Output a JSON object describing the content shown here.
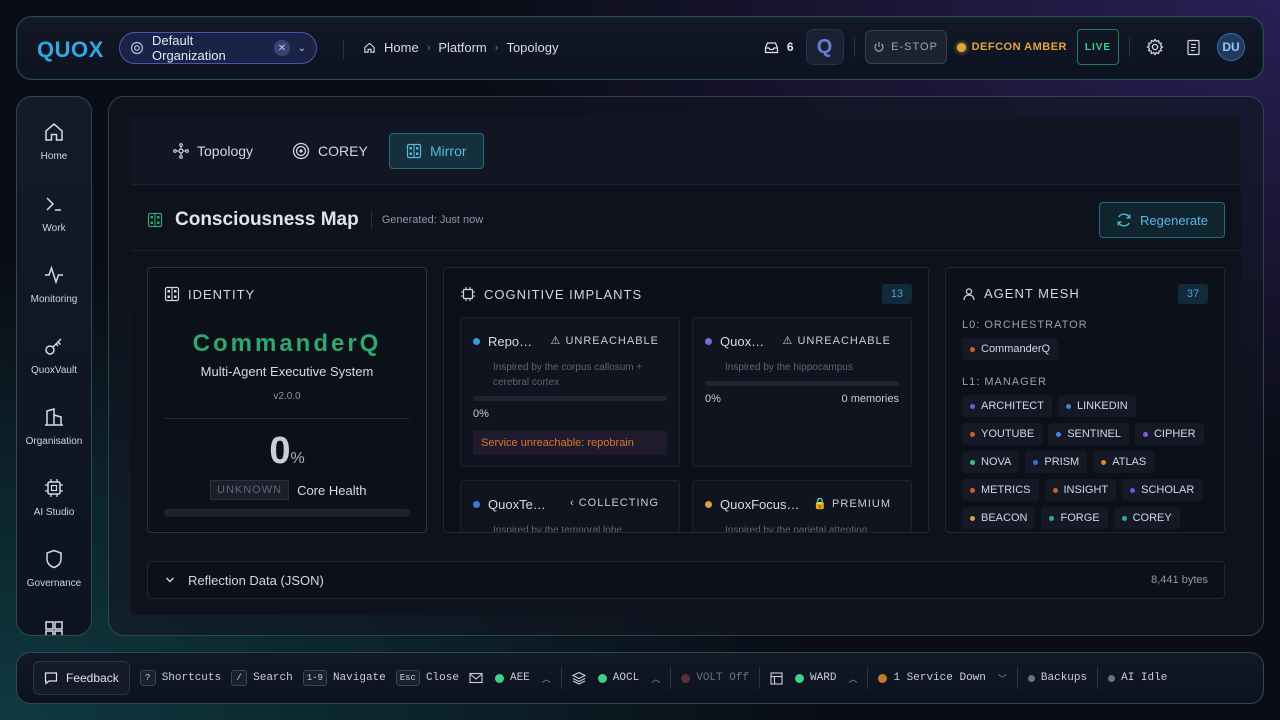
{
  "app": {
    "logo": "QUOX"
  },
  "org": {
    "name": "Default Organization"
  },
  "breadcrumbs": [
    "Home",
    "Platform",
    "Topology"
  ],
  "header": {
    "inbox_count": "6",
    "q_label": "Q",
    "estop_label": "E-STOP",
    "defcon_label": "DEFCON AMBER",
    "live_label": "LIVE",
    "avatar_initials": "DU"
  },
  "sidebar": {
    "items": [
      {
        "label": "Home",
        "icon": "home-icon"
      },
      {
        "label": "Work",
        "icon": "terminal-icon"
      },
      {
        "label": "Monitoring",
        "icon": "activity-icon"
      },
      {
        "label": "QuoxVault",
        "icon": "key-icon"
      },
      {
        "label": "Organisation",
        "icon": "building-icon"
      },
      {
        "label": "AI Studio",
        "icon": "chip-icon"
      },
      {
        "label": "Governance",
        "icon": "shield-icon"
      }
    ]
  },
  "tabs": [
    {
      "label": "Topology",
      "icon": "topology-icon"
    },
    {
      "label": "COREY",
      "icon": "target-icon"
    },
    {
      "label": "Mirror",
      "icon": "mirror-icon",
      "active": true
    }
  ],
  "map": {
    "title": "Consciousness Map",
    "generated": "Generated: Just now",
    "regenerate_label": "Regenerate"
  },
  "identity": {
    "title": "IDENTITY",
    "name": "CommanderQ",
    "subtitle": "Multi-Agent Executive System",
    "version": "v2.0.0",
    "health_value": "0",
    "health_unit": "%",
    "health_status": "UNKNOWN",
    "health_label": "Core Health",
    "health_fraction": 0
  },
  "implants": {
    "title": "COGNITIVE IMPLANTS",
    "count": "13",
    "cards": [
      {
        "name": "Repo…",
        "status": "⚠ UNREACHABLE",
        "inspired": "Inspired by the corpus callosum + cerebral cortex",
        "pct": "0%",
        "error": "Service unreachable: repobrain",
        "color": "#3a9ad6"
      },
      {
        "name": "Quox…",
        "status": "⚠ UNREACHABLE",
        "inspired": "Inspired by the hippocampus",
        "pct": "0%",
        "memories": "0 memories",
        "color": "#7a6ad6"
      },
      {
        "name": "QuoxTe…",
        "status": "‹ COLLECTING",
        "inspired": "Inspired by the temporal lobe",
        "color": "#3a7ad6"
      },
      {
        "name": "QuoxFocus…",
        "status": "🔒 PREMIUM",
        "inspired": "Inspired by the parietal attention network",
        "color": "#d6a23a"
      }
    ]
  },
  "mesh": {
    "title": "AGENT MESH",
    "count": "37",
    "tiers": [
      {
        "label": "L0: ORCHESTRATOR",
        "agents": [
          {
            "name": "CommanderQ",
            "color": "#c8602a"
          }
        ]
      },
      {
        "label": "L1: MANAGER",
        "agents": [
          {
            "name": "ARCHITECT",
            "color": "#6a5ad6"
          },
          {
            "name": "LINKEDIN",
            "color": "#3a8ad6"
          },
          {
            "name": "YOUTUBE",
            "color": "#c8602a"
          },
          {
            "name": "SENTINEL",
            "color": "#3a8ad6"
          },
          {
            "name": "CIPHER",
            "color": "#8a5ad6"
          },
          {
            "name": "NOVA",
            "color": "#3ac07a"
          },
          {
            "name": "PRISM",
            "color": "#3a6ad6"
          },
          {
            "name": "ATLAS",
            "color": "#d68a2a"
          },
          {
            "name": "METRICS",
            "color": "#c8602a"
          },
          {
            "name": "INSIGHT",
            "color": "#c8602a"
          },
          {
            "name": "SCHOLAR",
            "color": "#6a5ad6"
          },
          {
            "name": "BEACON",
            "color": "#d6a23a"
          },
          {
            "name": "FORGE",
            "color": "#2ab08a"
          },
          {
            "name": "COREY",
            "color": "#2ab08a"
          }
        ]
      }
    ]
  },
  "reflection": {
    "label": "Reflection Data (JSON)",
    "bytes": "8,441 bytes"
  },
  "statusbar": {
    "feedback": "Feedback",
    "shortcuts": [
      {
        "key": "?",
        "label": "Shortcuts"
      },
      {
        "key": "/",
        "label": "Search"
      },
      {
        "key": "1-9",
        "label": "Navigate"
      },
      {
        "key": "Esc",
        "label": "Close"
      }
    ],
    "aee": "AEE",
    "aocl": "AOCL",
    "volt": "VOLT Off",
    "ward": "WARD",
    "service": "1 Service Down",
    "backups": "Backups",
    "ai": "AI Idle"
  }
}
